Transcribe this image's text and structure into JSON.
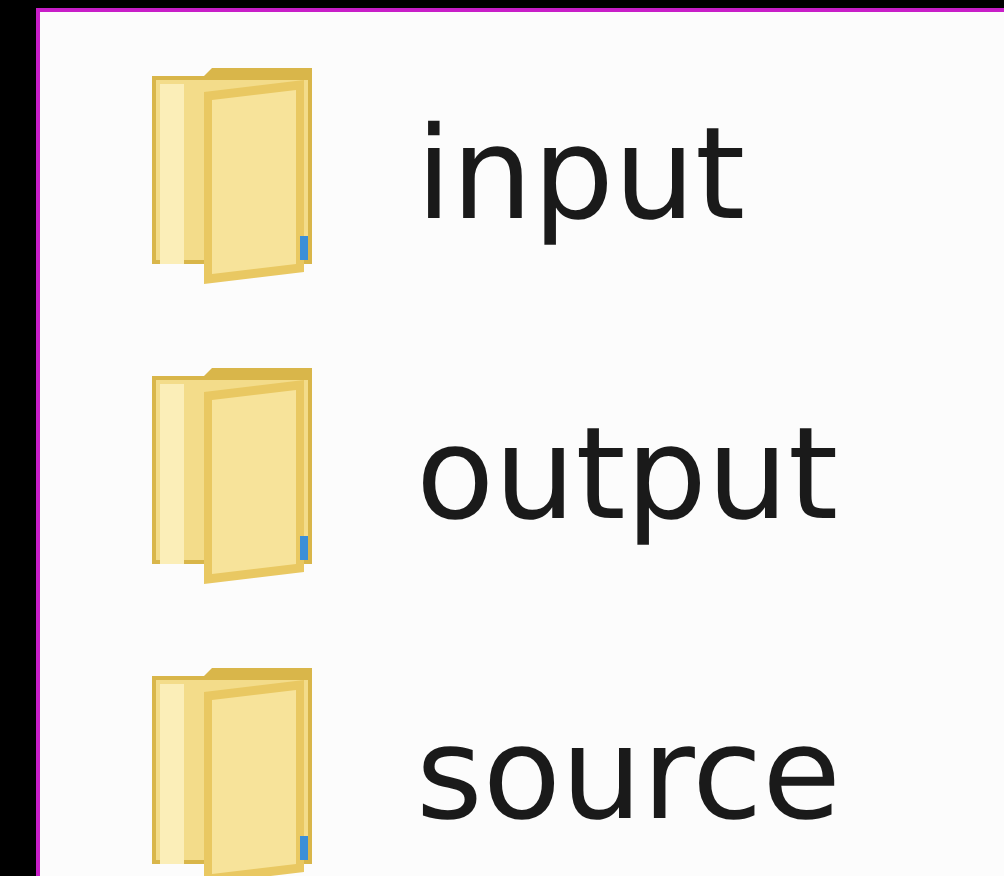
{
  "items": [
    {
      "name": "input",
      "kind": "folder"
    },
    {
      "name": "output",
      "kind": "folder"
    },
    {
      "name": "source",
      "kind": "folder"
    }
  ]
}
